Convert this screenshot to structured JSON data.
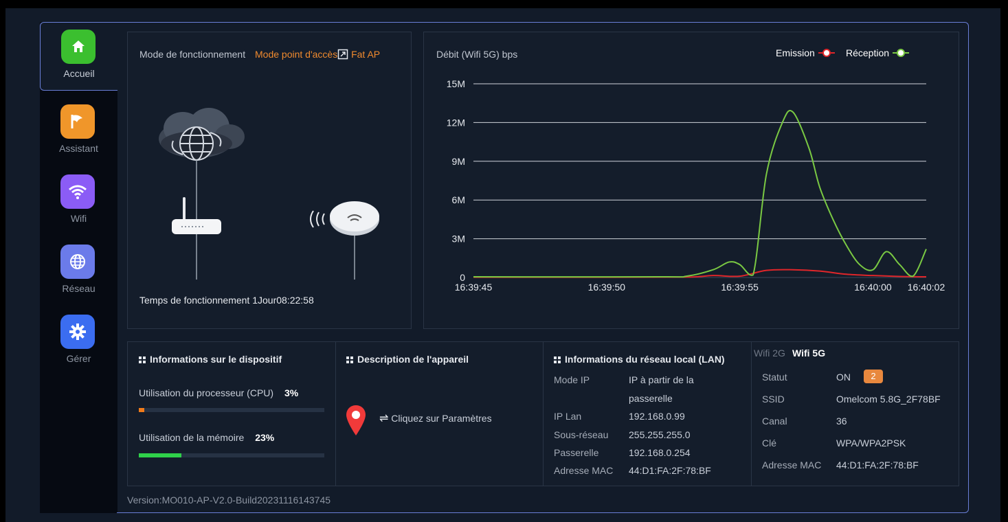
{
  "sidebar": {
    "items": [
      {
        "label": "Accueil",
        "icon": "home-icon",
        "color": "#3bbf2f",
        "active": true
      },
      {
        "label": "Assistant",
        "icon": "flag-icon",
        "color": "#f0962a"
      },
      {
        "label": "Wifi",
        "icon": "wifi-icon",
        "color": "#8b5cf6"
      },
      {
        "label": "Réseau",
        "icon": "globe-icon",
        "color": "#6b7bea"
      },
      {
        "label": "Gérer",
        "icon": "gear-icon",
        "color": "#3b6df0"
      }
    ]
  },
  "mode": {
    "label": "Mode de fonctionnement",
    "value": "Mode point d'accès",
    "fat_ap": "Fat AP",
    "uptime_label": "Temps de fonctionnement",
    "uptime_value": "1Jour08:22:58"
  },
  "chart_data": {
    "type": "line",
    "title": "Débit (Wifi 5G) bps",
    "yticks": [
      "15M",
      "12M",
      "9M",
      "6M",
      "3M",
      "0"
    ],
    "xticks": [
      "16:39:45",
      "16:39:50",
      "16:39:55",
      "16:40:00",
      "16:40:02"
    ],
    "ylim": [
      0,
      15
    ],
    "xlim": [
      0,
      17
    ],
    "series": [
      {
        "name": "Emission",
        "color": "#e0262a",
        "x": [
          0,
          5,
          8,
          9,
          10,
          11,
          12,
          13,
          14,
          15,
          16,
          17
        ],
        "y": [
          0.02,
          0.02,
          0.03,
          0.15,
          0.1,
          0.55,
          0.6,
          0.5,
          0.25,
          0.15,
          0.08,
          0.05
        ]
      },
      {
        "name": "Réception",
        "color": "#7ac943",
        "x": [
          0,
          7,
          8,
          9,
          9.6,
          10,
          10.5,
          11,
          11.6,
          12,
          12.6,
          13,
          13.5,
          14,
          14.5,
          15,
          15.5,
          16,
          16.5,
          17
        ],
        "y": [
          0.05,
          0.05,
          0.1,
          0.6,
          1.2,
          1.0,
          0.2,
          8.0,
          12.0,
          12.8,
          10.0,
          7.0,
          4.5,
          2.5,
          1.0,
          0.6,
          2.0,
          1.0,
          0.1,
          2.2
        ]
      }
    ],
    "legend": [
      "Emission",
      "Réception"
    ],
    "grid": true
  },
  "device_info": {
    "title": "Informations sur le dispositif",
    "cpu_label": "Utilisation du processeur (CPU)",
    "cpu_value": "3%",
    "cpu_fraction": 0.03,
    "mem_label": "Utilisation de la mémoire",
    "mem_value": "23%",
    "mem_fraction": 0.23,
    "cpu_color": "#f07b1a",
    "mem_color": "#2fd14a"
  },
  "device_desc": {
    "title": "Description de l'appareil",
    "action": "Cliquez sur Paramètres"
  },
  "lan": {
    "title": "Informations du réseau local (LAN)",
    "rows": [
      {
        "label": "Mode IP",
        "value": "IP à partir de la"
      },
      {
        "label": "",
        "value": "passerelle"
      },
      {
        "label": "IP Lan",
        "value": "192.168.0.99"
      },
      {
        "label": "Sous-réseau",
        "value": "255.255.255.0"
      },
      {
        "label": "Passerelle",
        "value": "192.168.0.254"
      },
      {
        "label": "Adresse MAC",
        "value": "44:D1:FA:2F:78:BF"
      }
    ]
  },
  "wifi": {
    "tabs": [
      "Wifi 2G",
      "Wifi 5G"
    ],
    "active_tab": "Wifi 5G",
    "status_label": "Statut",
    "status_value": "ON",
    "clients": "2",
    "rows": [
      {
        "label": "SSID",
        "value": "Omelcom 5.8G_2F78BF"
      },
      {
        "label": "Canal",
        "value": "36"
      },
      {
        "label": "Clé",
        "value": "WPA/WPA2PSK"
      },
      {
        "label": "Adresse MAC",
        "value": "44:D1:FA:2F:78:BF"
      }
    ]
  },
  "footer": {
    "version": "Version:MO010-AP-V2.0-Build20231116143745"
  }
}
